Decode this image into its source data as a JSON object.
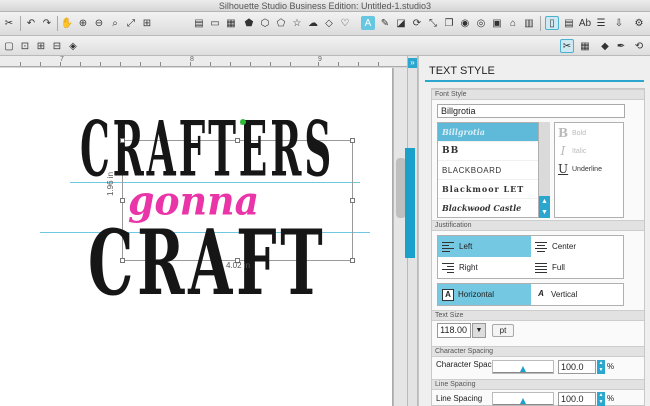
{
  "window": {
    "title": "Silhouette Studio Business Edition: Untitled-1.studio3"
  },
  "toolbar": {
    "icons": [
      "scissors-icon",
      "undo-icon",
      "redo-icon",
      "hand-icon",
      "zoom-in-icon",
      "zoom-out-icon",
      "zoom-area-icon",
      "fit-page-icon",
      "cut-settings-icon",
      "grid-icon",
      "pentagon-icon",
      "polygon-icon",
      "star-icon",
      "cloud-icon",
      "heart-icon",
      "text-icon",
      "knife-icon",
      "transform-icon",
      "rotate-icon",
      "replicate-icon",
      "offset-icon",
      "trace-icon",
      "store-icon",
      "library-icon",
      "page-icon",
      "send-icon",
      "font-icon",
      "settings-icon"
    ],
    "text_tool_glyph": "A",
    "font_glyph": "Ab"
  },
  "canvas": {
    "ruler_numbers": [
      "7",
      "8",
      "9"
    ],
    "art_lines": [
      "CRAFTERS",
      "gonna",
      "CRAFT"
    ],
    "width_label": "4.02 in",
    "height_label": "1.96 in"
  },
  "panel": {
    "title": "TEXT STYLE",
    "collapse_glyph": "»",
    "font_style_heading": "Font Style",
    "font_name": "Billgrotia",
    "font_list": [
      "Billgrotia",
      "BB",
      "BLACKBOARD",
      "Blackmoor LET",
      "Blackwood Castle"
    ],
    "styles": [
      {
        "glyph": "B",
        "label": "Bold"
      },
      {
        "glyph": "I",
        "label": "Italic"
      },
      {
        "glyph": "U",
        "label": "Underline"
      }
    ],
    "justification_heading": "Justification",
    "justification": [
      "Left",
      "Center",
      "Right",
      "Full"
    ],
    "directions": [
      "Horizontal",
      "Vertical"
    ],
    "text_size_heading": "Text Size",
    "text_size_value": "118.00",
    "text_size_unit": "pt",
    "character_spacing_heading": "Character Spacing",
    "character_spacing_label": "Character Spacing",
    "character_spacing_value": "100.0",
    "character_spacing_position": 0.5,
    "line_spacing_heading": "Line Spacing",
    "line_spacing_label": "Line Spacing",
    "line_spacing_value": "100.0",
    "line_spacing_position": 0.5,
    "percent_sign": "%",
    "accent_color": "#2aa6cf",
    "highlight_color": "#74c8e2"
  }
}
